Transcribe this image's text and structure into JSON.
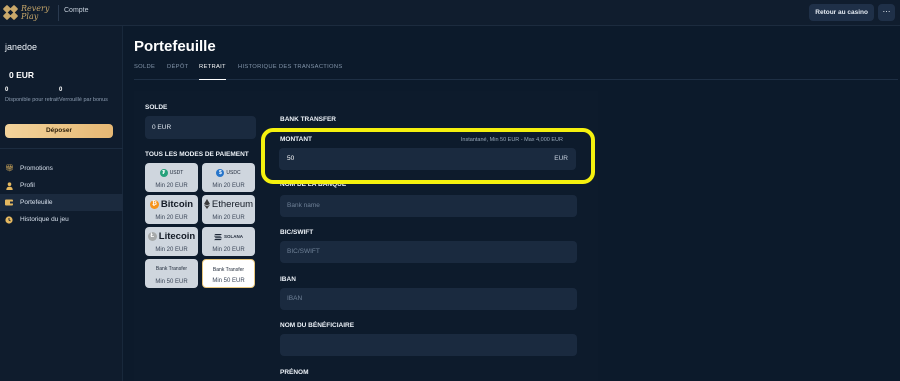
{
  "brand": {
    "logo_text_1": "Revery",
    "logo_text_2": "Play"
  },
  "topbar": {
    "nav_label": "Compte",
    "return_button": "Retour au casino",
    "more_button": "⋯"
  },
  "sidebar": {
    "username": "janedoe",
    "balance": "0  EUR",
    "withdrawable_amount": "0",
    "withdrawable_label": "Disponible pour retrait",
    "locked_amount": "0",
    "locked_label": "Verrouillé par bonus",
    "deposit_button": "Déposer",
    "items": [
      {
        "label": "Promotions",
        "icon": "gift-icon"
      },
      {
        "label": "Profil",
        "icon": "user-icon"
      },
      {
        "label": "Portefeuille",
        "icon": "wallet-icon"
      },
      {
        "label": "Historique du jeu",
        "icon": "history-icon"
      }
    ]
  },
  "page": {
    "title": "Portefeuille",
    "tabs": [
      "SOLDE",
      "DÉPÔT",
      "RETRAIT",
      "HISTORIQUE DES TRANSACTIONS"
    ],
    "active_tab": "RETRAIT"
  },
  "withdraw": {
    "solde_label": "SOLDE",
    "solde_value": "0 EUR",
    "modes_label": "TOUS LES MODES DE PAIEMENT",
    "methods": [
      {
        "name": "USDT",
        "min": "Min 20 EUR",
        "icon": "tether-icon",
        "color": "#26a17b"
      },
      {
        "name": "USDC",
        "min": "Min 20 EUR",
        "icon": "usdc-icon",
        "color": "#2775ca"
      },
      {
        "name": "Bitcoin",
        "min": "Min 20 EUR",
        "icon": "bitcoin-icon",
        "color": "#f7931a"
      },
      {
        "name": "Ethereum",
        "min": "Min 20 EUR",
        "icon": "ethereum-icon",
        "color": "#3c3c3d"
      },
      {
        "name": "Litecoin",
        "min": "Min 20 EUR",
        "icon": "litecoin-icon",
        "color": "#a6a9aa"
      },
      {
        "name": "SOLANA",
        "min": "Min 20 EUR",
        "icon": "solana-icon",
        "color": "#14f195"
      },
      {
        "name": "Bank Transfer",
        "min": "Min 50 EUR",
        "icon": "bank-icon",
        "color": "#1c2636"
      },
      {
        "name": "Bank Transfer",
        "min": "Min 50 EUR",
        "icon": "bank-icon",
        "color": "#1c2636"
      }
    ],
    "selected_method": "Bank Transfer",
    "form_title": "BANK TRANSFER",
    "montant_label": "MONTANT",
    "montant_hint": "Instantané, Min 50 EUR - Max 4,000 EUR",
    "montant_value": "50",
    "montant_unit": "EUR",
    "bank_name_label": "NOM DE LA BANQUE",
    "bank_name_placeholder": "Bank name",
    "bic_label": "BIC/SWIFT",
    "bic_placeholder": "BIC/SWIFT",
    "iban_label": "IBAN",
    "iban_placeholder": "IBAN",
    "beneficiary_label": "NOM DU BÉNÉFICIAIRE",
    "beneficiary_placeholder": "",
    "prenom_label": "PRÉNOM"
  },
  "colors": {
    "accent": "#e6b874",
    "highlight": "#f5f10e",
    "background": "#0c1a2b"
  }
}
